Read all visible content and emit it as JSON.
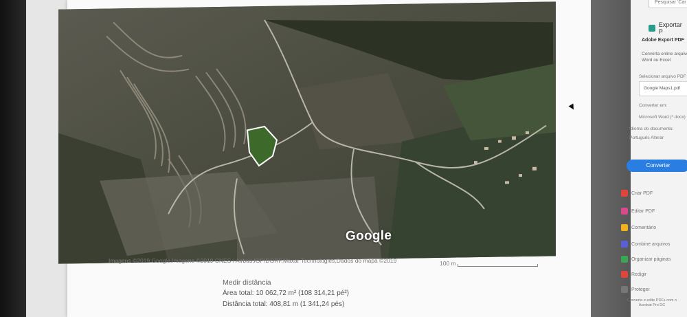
{
  "map": {
    "logo": "Google",
    "attribution": "Imagens ©2019 Google,Imagens ©2019 CNES / Airbus,IGP/DGRF,Maxar Technologies,Dados do mapa ©2019",
    "scale_label": "100 m"
  },
  "measure": {
    "title": "Medir distância",
    "area": "Área total: 10 062,72 m² (108 314,21 pé²)",
    "distance": "Distância total: 408,81 m (1 341,24 pés)"
  },
  "panel": {
    "search_placeholder": "Pesquisar 'Car",
    "export_tool": "Exportar P",
    "section_title": "Adobe Export PDF",
    "section_desc": "Converta online arquivos Word ou Excel",
    "select_label": "Selecionar arquivo PDF",
    "selected_file": "Google Maps1.pdf",
    "convert_to_label": "Converter em:",
    "convert_to_value": "Microsoft Word (*.docx)",
    "language_label": "Idioma do documento:",
    "language_value": "Português  Alterar",
    "convert_button": "Converter",
    "tools": [
      {
        "label": "Criar PDF",
        "icon": "create-pdf-icon",
        "color": "#e0443a"
      },
      {
        "label": "Editar PDF",
        "icon": "edit-pdf-icon",
        "color": "#d94a8c"
      },
      {
        "label": "Comentário",
        "icon": "comment-icon",
        "color": "#f2b21b"
      },
      {
        "label": "Combine arquivos",
        "icon": "combine-files-icon",
        "color": "#5b5fd6"
      },
      {
        "label": "Organizar páginas",
        "icon": "organize-pages-icon",
        "color": "#3aa655"
      },
      {
        "label": "Redigir",
        "icon": "redact-icon",
        "color": "#e0443a"
      },
      {
        "label": "Proteger",
        "icon": "protect-icon",
        "color": "#777777"
      }
    ],
    "footer": "Converta e edite PDFs com o Acrobat Pro DC"
  }
}
